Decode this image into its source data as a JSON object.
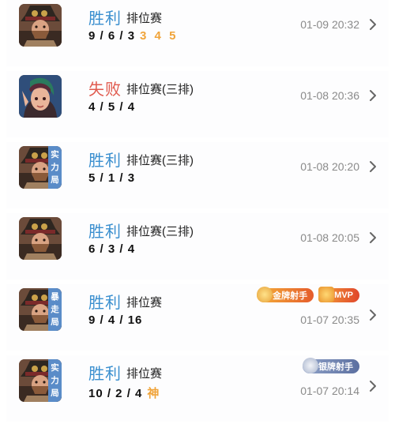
{
  "matches": [
    {
      "result": "胜利",
      "result_type": "win",
      "mode": "排位赛",
      "kda": "9 / 6 / 3",
      "extra": "3 4 5",
      "time": "01-09 20:32",
      "hero": "gunslinger-hero-icon",
      "mode_tag": null,
      "badges": []
    },
    {
      "result": "失败",
      "result_type": "lose",
      "mode": "排位赛(三排)",
      "kda": "4 / 5 / 4",
      "extra": "",
      "time": "01-08 20:36",
      "hero": "elf-archer-hero-icon",
      "mode_tag": null,
      "badges": []
    },
    {
      "result": "胜利",
      "result_type": "win",
      "mode": "排位赛(三排)",
      "kda": "5 / 1 / 3",
      "extra": "",
      "time": "01-08 20:20",
      "hero": "gunslinger-hero-icon",
      "mode_tag": [
        "实",
        "力",
        "局"
      ],
      "badges": []
    },
    {
      "result": "胜利",
      "result_type": "win",
      "mode": "排位赛(三排)",
      "kda": "6 / 3 / 4",
      "extra": "",
      "time": "01-08 20:05",
      "hero": "gunslinger-hero-icon",
      "mode_tag": null,
      "badges": []
    },
    {
      "result": "胜利",
      "result_type": "win",
      "mode": "排位赛",
      "kda": "9 / 4 / 16",
      "extra": "",
      "time": "01-07 20:35",
      "hero": "gunslinger-hero-icon",
      "mode_tag": [
        "暴",
        "走",
        "局"
      ],
      "badges": [
        {
          "label": "金牌射手",
          "style": "gold"
        },
        {
          "label": "MVP",
          "style": "mvp"
        }
      ]
    },
    {
      "result": "胜利",
      "result_type": "win",
      "mode": "排位赛",
      "kda": "10 / 2 / 4",
      "extra": "神",
      "time": "01-07 20:14",
      "hero": "gunslinger-hero-icon",
      "mode_tag": [
        "实",
        "力",
        "局"
      ],
      "badges": [
        {
          "label": "银牌射手",
          "style": "silver"
        }
      ]
    }
  ],
  "colors": {
    "win": "#3a8fcf",
    "lose": "#e05a4e",
    "extra": "#f0a43a",
    "time": "#8a8a8a",
    "tag_bg": "#5a8cc8"
  }
}
